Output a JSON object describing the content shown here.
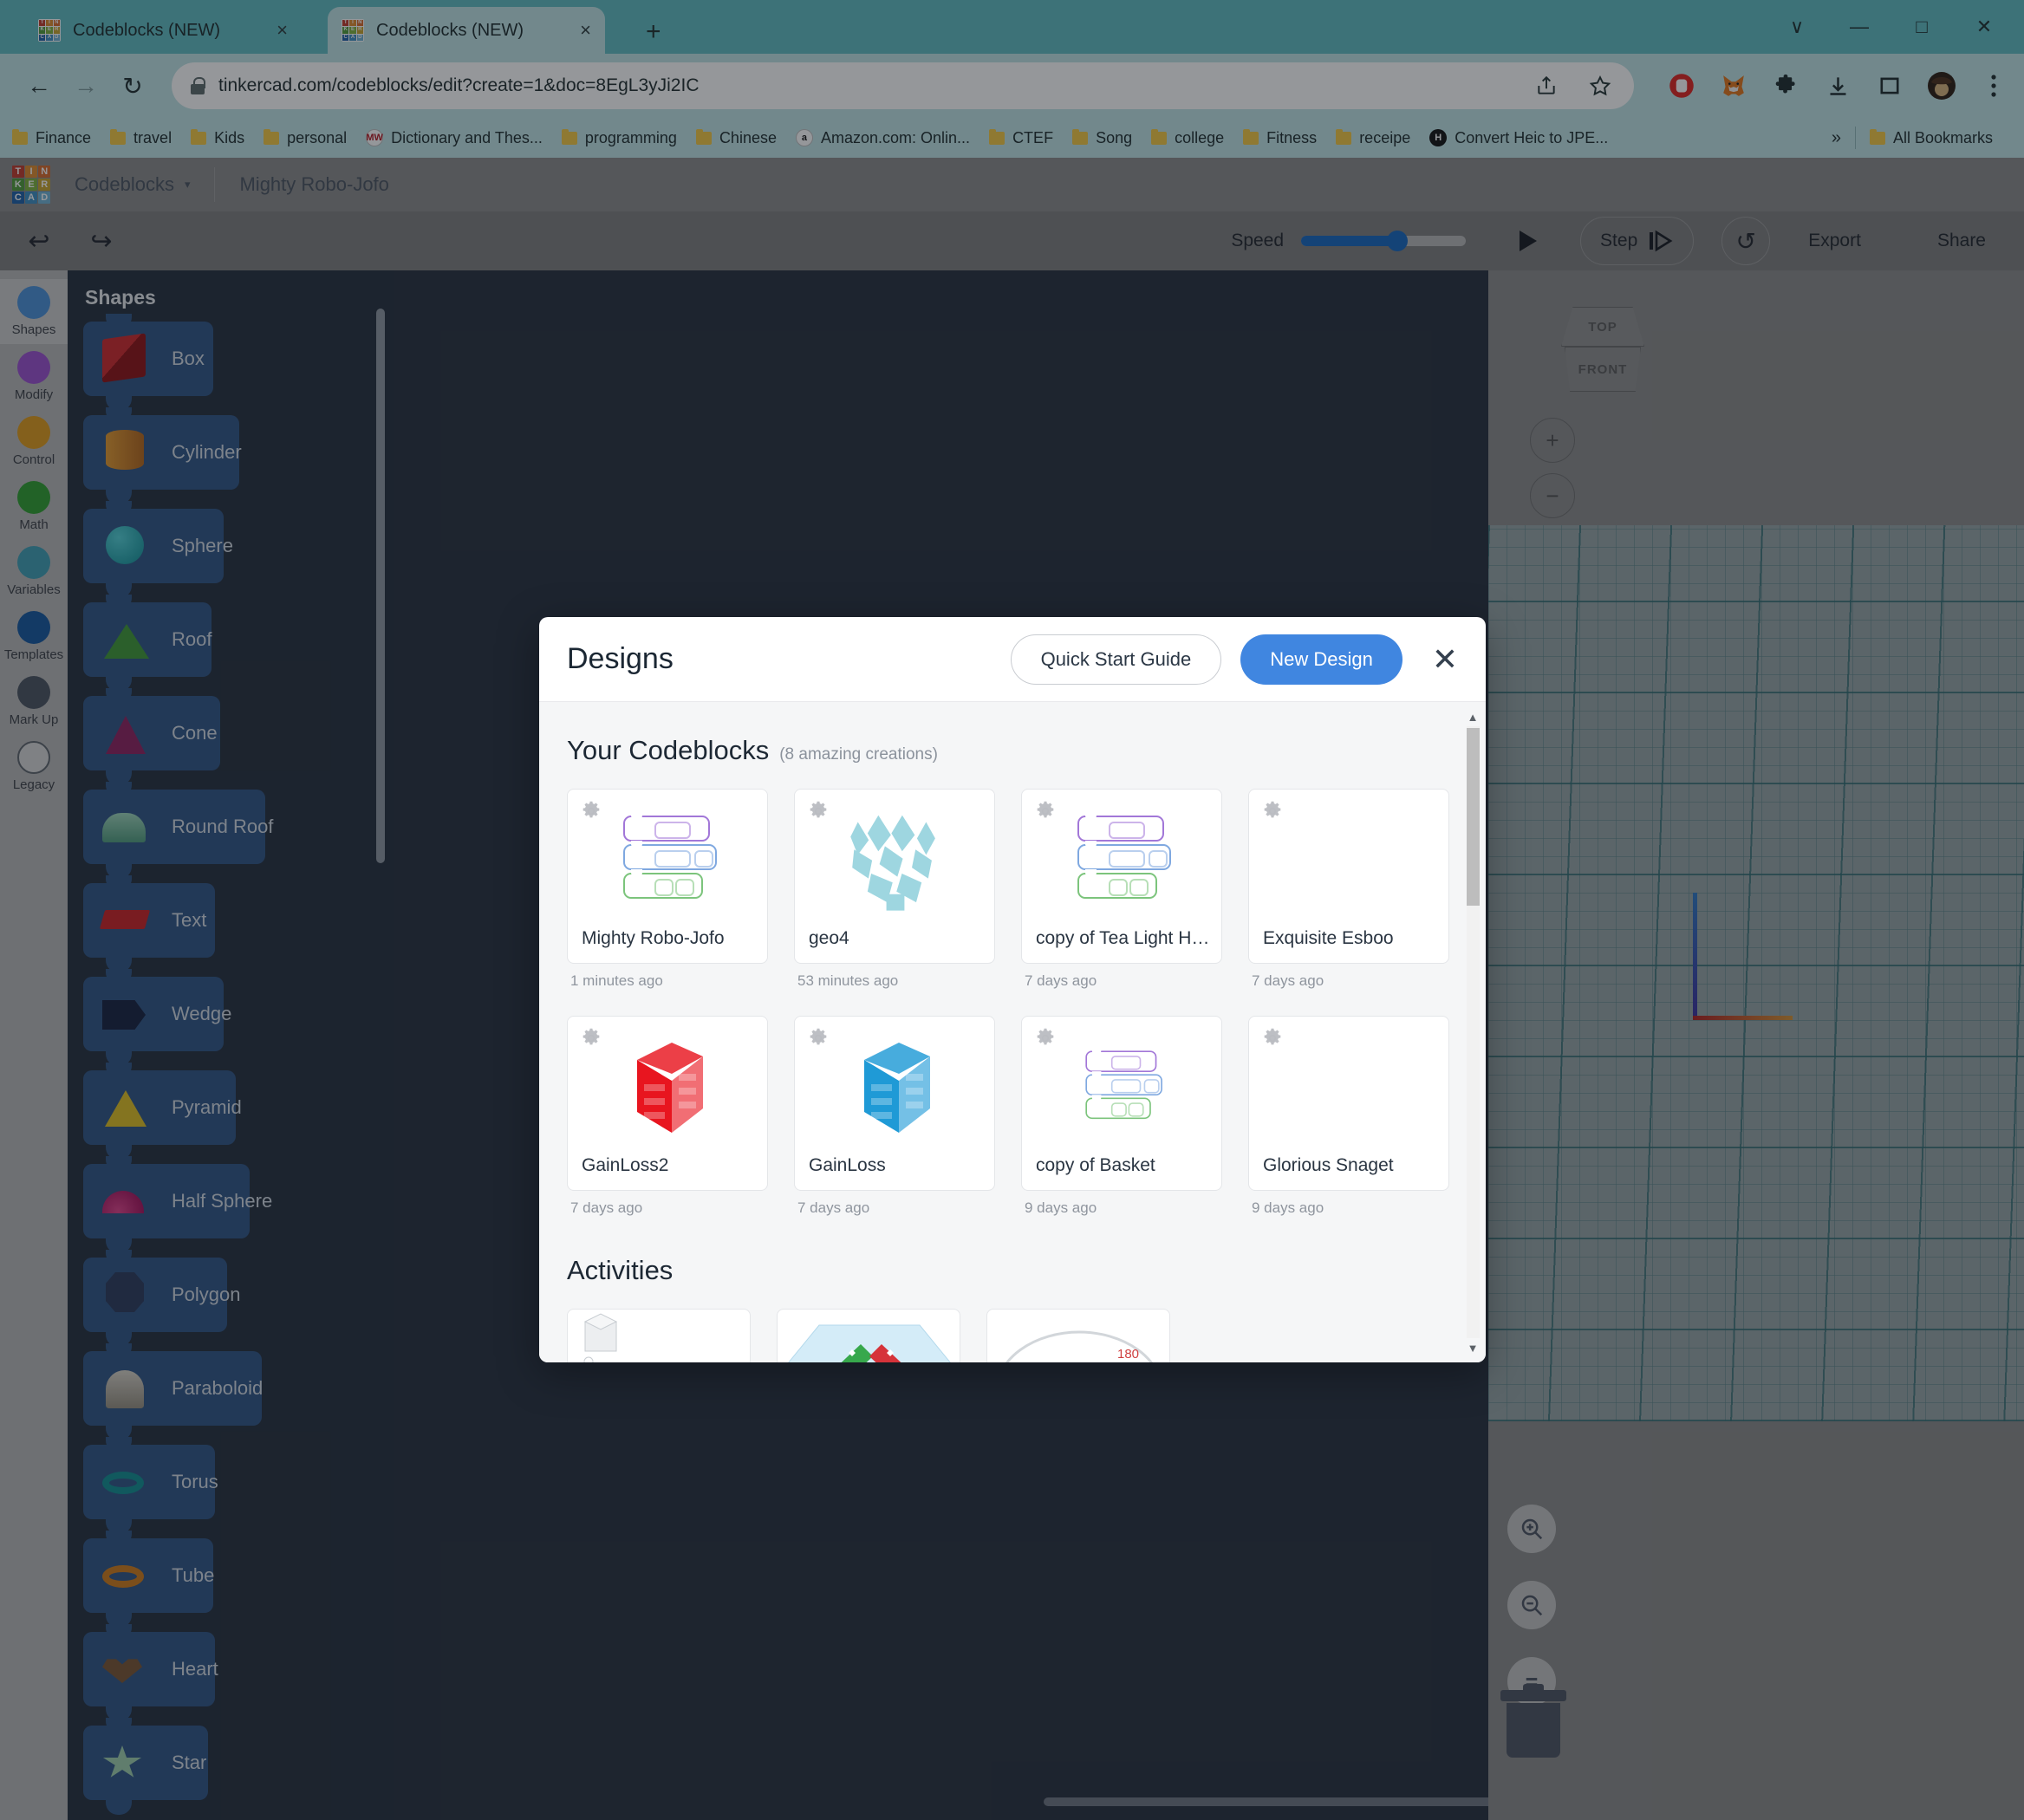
{
  "browser": {
    "tabs": [
      {
        "title": "Codeblocks (NEW)",
        "close": "×"
      },
      {
        "title": "Codeblocks (NEW)",
        "close": "×"
      }
    ],
    "new_tab_label": "+",
    "window_controls": {
      "collapse": "∨",
      "minimize": "—",
      "maximize": "□",
      "close": "✕"
    },
    "nav": {
      "back": "←",
      "forward": "→",
      "reload": "↻"
    },
    "url": "tinkercad.com/codeblocks/edit?create=1&doc=8EgL3yJi2IC",
    "bookmarks": [
      {
        "label": "Finance",
        "icon": "folder-icon"
      },
      {
        "label": "travel",
        "icon": "folder-icon"
      },
      {
        "label": "Kids",
        "icon": "folder-icon"
      },
      {
        "label": "personal",
        "icon": "folder-icon"
      },
      {
        "label": "Dictionary and Thes...",
        "icon": "merriam-webster-icon",
        "glyph": "MW",
        "bg": "#ffffff",
        "fg": "#b3141f"
      },
      {
        "label": "programming",
        "icon": "folder-icon"
      },
      {
        "label": "Chinese",
        "icon": "folder-icon"
      },
      {
        "label": "Amazon.com: Onlin...",
        "icon": "amazon-icon",
        "glyph": "a",
        "bg": "#ffffff",
        "fg": "#111111"
      },
      {
        "label": "CTEF",
        "icon": "folder-icon"
      },
      {
        "label": "Song",
        "icon": "folder-icon"
      },
      {
        "label": "college",
        "icon": "folder-icon"
      },
      {
        "label": "Fitness",
        "icon": "folder-icon"
      },
      {
        "label": "receipe",
        "icon": "folder-icon"
      },
      {
        "label": "Convert Heic to JPE...",
        "icon": "heic-icon",
        "glyph": "H",
        "bg": "#111111",
        "fg": "#ffffff"
      }
    ],
    "bookmarks_overflow": "»",
    "all_bookmarks": "All Bookmarks"
  },
  "app": {
    "logo_tiles": [
      {
        "letter": "T",
        "color": "#c1392b"
      },
      {
        "letter": "I",
        "color": "#e08b2c"
      },
      {
        "letter": "N",
        "color": "#d96a2a"
      },
      {
        "letter": "K",
        "color": "#4f9c3a"
      },
      {
        "letter": "E",
        "color": "#7eb23d"
      },
      {
        "letter": "R",
        "color": "#c9a52c"
      },
      {
        "letter": "C",
        "color": "#1d5fa8"
      },
      {
        "letter": "A",
        "color": "#3d8fc4"
      },
      {
        "letter": "D",
        "color": "#6fb3d6"
      }
    ],
    "menu_label": "Codeblocks",
    "menu_caret": "▾",
    "doc_name": "Mighty Robo-Jofo",
    "toolbar": {
      "undo": "↩",
      "redo": "↪",
      "speed_label": "Speed",
      "speed_value": 58,
      "play_label": "play-button",
      "step_label": "Step",
      "restart_label": "↺",
      "export_label": "Export",
      "share_label": "Share"
    }
  },
  "categories": [
    {
      "label": "Shapes",
      "color": "#4a90d9",
      "active": true
    },
    {
      "label": "Modify",
      "color": "#9b4fd0",
      "active": false
    },
    {
      "label": "Control",
      "color": "#e09b1a",
      "active": false
    },
    {
      "label": "Math",
      "color": "#2f9e2f",
      "active": false
    },
    {
      "label": "Variables",
      "color": "#3e9fb5",
      "active": false
    },
    {
      "label": "Templates",
      "color": "#13569e",
      "active": false
    },
    {
      "label": "Mark Up",
      "color": "#4a5360",
      "active": false
    },
    {
      "label": "Legacy",
      "color": "#d7d7d7",
      "active": false
    }
  ],
  "palette": {
    "title": "Shapes",
    "blocks": [
      {
        "label": "Box",
        "glyph": "g-box"
      },
      {
        "label": "Cylinder",
        "glyph": "g-cyl"
      },
      {
        "label": "Sphere",
        "glyph": "g-sph"
      },
      {
        "label": "Roof",
        "glyph": "g-tri"
      },
      {
        "label": "Cone",
        "glyph": "g-cone"
      },
      {
        "label": "Round Roof",
        "glyph": "g-rroof"
      },
      {
        "label": "Text",
        "glyph": "g-text"
      },
      {
        "label": "Wedge",
        "glyph": "g-wedge"
      },
      {
        "label": "Pyramid",
        "glyph": "g-pyr"
      },
      {
        "label": "Half Sphere",
        "glyph": "g-half"
      },
      {
        "label": "Polygon",
        "glyph": "g-poly"
      },
      {
        "label": "Paraboloid",
        "glyph": "g-para"
      },
      {
        "label": "Torus",
        "glyph": "g-torus"
      },
      {
        "label": "Tube",
        "glyph": "g-tube"
      },
      {
        "label": "Heart",
        "glyph": "g-heart"
      },
      {
        "label": "Star",
        "glyph": "g-star"
      }
    ]
  },
  "viewer": {
    "cube_top": "TOP",
    "cube_front": "FRONT",
    "zoom_in": "+",
    "zoom_out": "−",
    "fit_view": "fit-to-view-icon",
    "zoom_in_glass": "zoom-in-icon",
    "zoom_out_glass": "zoom-out-icon",
    "zoom_reset": "=",
    "trash": "trash-icon"
  },
  "modal": {
    "title": "Designs",
    "quick_start": "Quick Start Guide",
    "new_design": "New Design",
    "close": "✕",
    "section_title": "Your Codeblocks",
    "section_sub": "(8 amazing creations)",
    "activities_title": "Activities",
    "scroll_up": "▲",
    "scroll_down": "▼",
    "designs": [
      {
        "name": "Mighty Robo-Jofo",
        "time": "1 minutes ago",
        "thumb": "codeblocks"
      },
      {
        "name": "geo4",
        "time": "53 minutes ago",
        "thumb": "geo-lattice",
        "color": "#9ed6e0"
      },
      {
        "name": "copy of Tea Light Ho...",
        "time": "7 days ago",
        "thumb": "codeblocks"
      },
      {
        "name": "Exquisite Esboo",
        "time": "7 days ago",
        "thumb": "empty"
      },
      {
        "name": "GainLoss2",
        "time": "7 days ago",
        "thumb": "solid-block",
        "color": "#e8151f"
      },
      {
        "name": "GainLoss",
        "time": "7 days ago",
        "thumb": "solid-block",
        "color": "#1f9ad6"
      },
      {
        "name": "copy of Basket",
        "time": "9 days ago",
        "thumb": "codeblocks-small"
      },
      {
        "name": "Glorious Snaget",
        "time": "9 days ago",
        "thumb": "empty"
      }
    ],
    "activities": [
      {
        "thumb": "cube-plate"
      },
      {
        "thumb": "arrows-plate"
      },
      {
        "thumb": "angle-plate"
      }
    ]
  }
}
